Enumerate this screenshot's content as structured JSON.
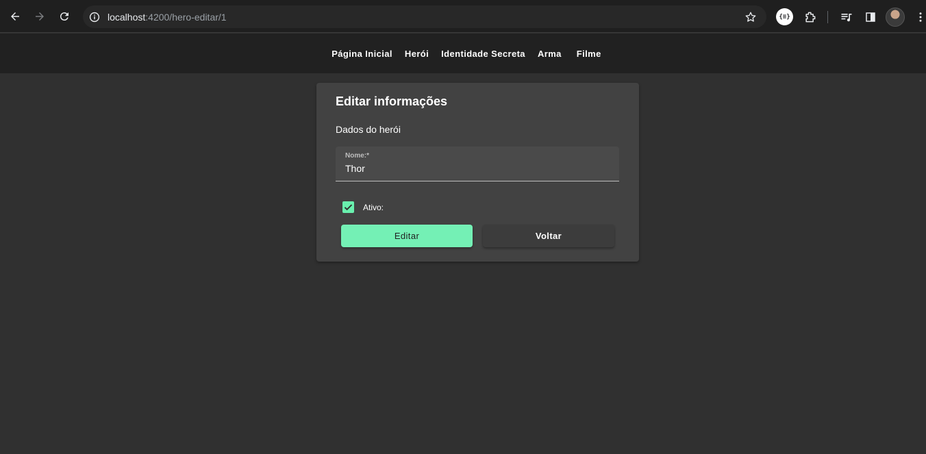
{
  "browser": {
    "url_host": "localhost",
    "url_path": ":4200/hero-editar/1",
    "json_ext_label": "{≡}"
  },
  "toolbar": {
    "menu": [
      {
        "label": "Página Inicial"
      },
      {
        "label": "Herói"
      },
      {
        "label": "Identidade Secreta"
      },
      {
        "label": "Arma"
      },
      {
        "label": "Filme"
      }
    ]
  },
  "card": {
    "title": "Editar informações",
    "subtitle": "Dados do herói",
    "name_field": {
      "label": "Nome:*",
      "value": "Thor"
    },
    "active_checkbox": {
      "label": "Ativo:",
      "checked": true
    },
    "edit_button": "Editar",
    "back_button": "Voltar"
  },
  "colors": {
    "accent": "#69f0ae",
    "background": "#303030",
    "toolbar": "#212121",
    "card": "#424242"
  }
}
